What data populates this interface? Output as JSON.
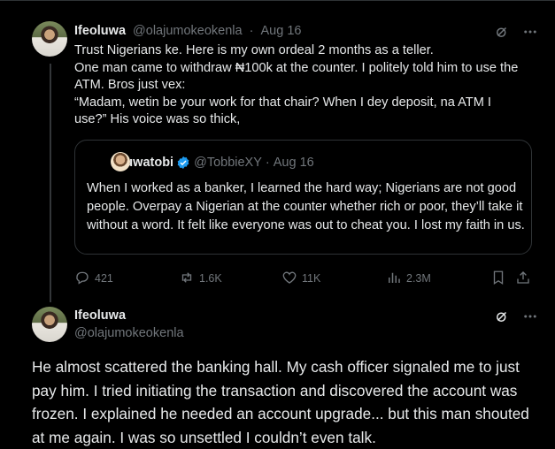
{
  "tweet1": {
    "author_name": "Ifeoluwa",
    "author_handle": "@olajumokeokenla",
    "separator": "·",
    "date": "Aug 16",
    "lines": [
      "Trust Nigerians ke. Here is my own ordeal 2 months as a teller.",
      "One man came to withdraw ₦100k at the counter. I politely told him to use the ATM. Bros just vex:",
      "“Madam, wetin be your work for that chair? When I dey deposit, na ATM I use?” His voice was so thick,"
    ],
    "quote": {
      "author_name": "Oluwatobi",
      "author_handle": "@TobbieXY",
      "separator": "·",
      "date": "Aug 16",
      "text": "When I worked as a banker, I learned the hard way; Nigerians are not good people. Overpay a Nigerian at the counter whether rich or poor, they’ll take it without a word. It felt like everyone was out to cheat you. I lost my faith in us."
    },
    "actions": {
      "replies": "421",
      "reposts": "1.6K",
      "likes": "11K",
      "views": "2.3M"
    }
  },
  "tweet2": {
    "author_name": "Ifeoluwa",
    "author_handle": "@olajumokeokenla",
    "text": "He almost scattered the banking hall. My cash officer signaled me to just pay him. I tried initiating the transaction and discovered the account was frozen. I explained he needed an account upgrade... but this man shouted at me again. I was so unsettled I couldn’t even talk."
  },
  "icons": {
    "grok": "grok-icon",
    "more": "more-icon",
    "reply": "reply-icon",
    "repost": "repost-icon",
    "like": "like-icon",
    "views": "views-icon",
    "bookmark": "bookmark-icon",
    "share": "share-icon",
    "verified": "verified-badge-icon"
  },
  "colors": {
    "background": "#000000",
    "text": "#e7e9ea",
    "muted": "#71767b",
    "border": "#2f3336",
    "verified": "#1d9bf0"
  }
}
